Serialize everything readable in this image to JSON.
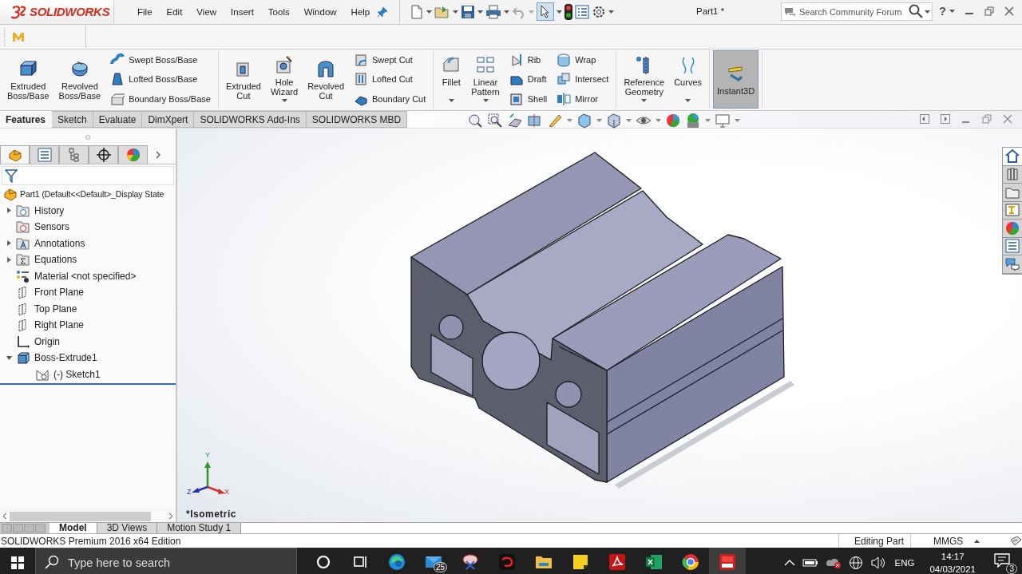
{
  "title_bar": {
    "logo": "SOLIDWORKS",
    "menu": [
      {
        "label": "File"
      },
      {
        "label": "Edit"
      },
      {
        "label": "View"
      },
      {
        "label": "Insert"
      },
      {
        "label": "Tools"
      },
      {
        "label": "Window"
      },
      {
        "label": "Help"
      }
    ],
    "document_title": "Part1 *",
    "search": {
      "placeholder": "Search Community Forum"
    },
    "help": "?"
  },
  "ribbon": {
    "groups": [
      {
        "columns": [
          {
            "kind": "large",
            "label": "Extruded Boss/Base",
            "dropdown": false,
            "pressed": false
          },
          {
            "kind": "large",
            "label": "Revolved Boss/Base",
            "dropdown": false,
            "pressed": false
          },
          {
            "kind": "stack",
            "items": [
              {
                "label": "Swept Boss/Base"
              },
              {
                "label": "Lofted Boss/Base"
              },
              {
                "label": "Boundary Boss/Base"
              }
            ]
          }
        ]
      },
      {
        "columns": [
          {
            "kind": "large",
            "label": "Extruded Cut",
            "dropdown": false,
            "pressed": false
          },
          {
            "kind": "large",
            "label": "Hole Wizard",
            "dropdown": true,
            "pressed": false
          },
          {
            "kind": "large",
            "label": "Revolved Cut",
            "dropdown": false,
            "pressed": false
          },
          {
            "kind": "stack",
            "items": [
              {
                "label": "Swept Cut"
              },
              {
                "label": "Lofted Cut"
              },
              {
                "label": "Boundary Cut"
              }
            ]
          }
        ]
      },
      {
        "columns": [
          {
            "kind": "large",
            "label": "Fillet",
            "dropdown": true,
            "pressed": false
          },
          {
            "kind": "large",
            "label": "Linear Pattern",
            "dropdown": true,
            "pressed": false
          },
          {
            "kind": "stack",
            "items": [
              {
                "label": "Rib"
              },
              {
                "label": "Draft"
              },
              {
                "label": "Shell"
              }
            ]
          },
          {
            "kind": "stack",
            "items": [
              {
                "label": "Wrap"
              },
              {
                "label": "Intersect"
              },
              {
                "label": "Mirror"
              }
            ]
          }
        ]
      },
      {
        "columns": [
          {
            "kind": "large",
            "label": "Reference Geometry",
            "dropdown": true,
            "pressed": false
          },
          {
            "kind": "large",
            "label": "Curves",
            "dropdown": true,
            "pressed": false
          }
        ]
      },
      {
        "columns": [
          {
            "kind": "large",
            "label": "Instant3D",
            "dropdown": false,
            "pressed": true
          }
        ]
      }
    ],
    "tabs": [
      {
        "label": "Features",
        "selected": true
      },
      {
        "label": "Sketch",
        "selected": false
      },
      {
        "label": "Evaluate",
        "selected": false
      },
      {
        "label": "DimXpert",
        "selected": false
      },
      {
        "label": "SOLIDWORKS Add-Ins",
        "selected": false
      },
      {
        "label": "SOLIDWORKS MBD",
        "selected": false
      }
    ]
  },
  "task_pane": [
    {
      "selected": true
    },
    {
      "selected": false
    },
    {
      "selected": false
    },
    {
      "selected": false
    },
    {
      "selected": false
    },
    {
      "selected": false
    },
    {
      "selected": false
    }
  ],
  "manager_tabs": [
    {
      "selected": true
    },
    {
      "selected": false
    },
    {
      "selected": false
    },
    {
      "selected": false
    },
    {
      "selected": false
    }
  ],
  "feature_tree": {
    "label": "Part1 (Default<<Default>_Display State",
    "kind": "part",
    "children": [
      {
        "label": "History",
        "kind": "history",
        "expanded": false
      },
      {
        "label": "Sensors",
        "kind": "sensors"
      },
      {
        "label": "Annotations",
        "kind": "annotations",
        "expanded": false
      },
      {
        "label": "Equations",
        "kind": "equations",
        "expanded": false
      },
      {
        "label": "Material <not specified>",
        "kind": "material"
      },
      {
        "label": "Front Plane",
        "kind": "plane"
      },
      {
        "label": "Top Plane",
        "kind": "plane"
      },
      {
        "label": "Right Plane",
        "kind": "plane"
      },
      {
        "label": "Origin",
        "kind": "origin"
      },
      {
        "label": "Boss-Extrude1",
        "kind": "feature",
        "expanded": true,
        "children": [
          {
            "label": "(-) Sketch1",
            "kind": "sketch"
          }
        ]
      }
    ]
  },
  "viewport": {
    "view_label": "*Isometric",
    "triad": {
      "x": "X",
      "y": "Y",
      "z": "Z"
    }
  },
  "model_tabs": [
    {
      "label": "Model",
      "selected": true
    },
    {
      "label": "3D Views",
      "selected": false
    },
    {
      "label": "Motion Study 1",
      "selected": false
    }
  ],
  "status_bar": {
    "text": "SOLIDWORKS Premium 2016 x64 Edition",
    "mode": "Editing Part",
    "units": "MMGS"
  },
  "taskbar": {
    "search": {
      "placeholder": "Type here to search"
    },
    "apps": [
      {
        "kind": "cortana",
        "active": false
      },
      {
        "kind": "taskview",
        "active": false
      },
      {
        "kind": "edge",
        "active": false
      },
      {
        "kind": "mail",
        "active": false,
        "badge": "25"
      },
      {
        "kind": "snip",
        "active": false
      },
      {
        "kind": "garena",
        "active": false
      },
      {
        "kind": "explorer",
        "active": false
      },
      {
        "kind": "notes",
        "active": false
      },
      {
        "kind": "acrobat",
        "active": false
      },
      {
        "kind": "excel",
        "active": false
      },
      {
        "kind": "chrome",
        "active": false
      },
      {
        "kind": "solidworks",
        "active": true
      }
    ],
    "language": "ENG",
    "time": "14:17",
    "date": "04/03/2021",
    "notifications": "3"
  }
}
